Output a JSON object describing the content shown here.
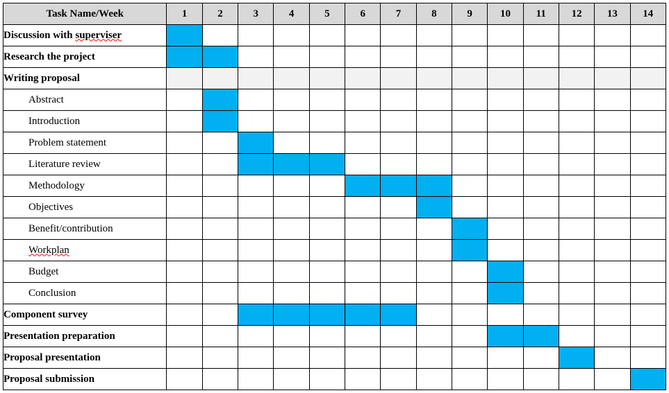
{
  "header": {
    "task_label": "Task Name/Week",
    "weeks": [
      "1",
      "2",
      "3",
      "4",
      "5",
      "6",
      "7",
      "8",
      "9",
      "10",
      "11",
      "12",
      "13",
      "14"
    ]
  },
  "rows": [
    {
      "label_html": "Discussion with <span class=\"squiggle\">superviser</span>",
      "bold": true,
      "indent": false,
      "fills": [
        1
      ],
      "shades": []
    },
    {
      "label_html": "Research the project",
      "bold": true,
      "indent": false,
      "fills": [
        1,
        2
      ],
      "shades": []
    },
    {
      "label_html": "Writing proposal",
      "bold": true,
      "indent": false,
      "fills": [],
      "shades": [
        1,
        2,
        3,
        4,
        5,
        6,
        7,
        8,
        9,
        10,
        11,
        12,
        13,
        14
      ]
    },
    {
      "label_html": "Abstract",
      "bold": false,
      "indent": true,
      "fills": [
        2
      ],
      "shades": []
    },
    {
      "label_html": "Introduction",
      "bold": false,
      "indent": true,
      "fills": [
        2
      ],
      "shades": []
    },
    {
      "label_html": "Problem statement",
      "bold": false,
      "indent": true,
      "fills": [
        3
      ],
      "shades": []
    },
    {
      "label_html": "Literature review",
      "bold": false,
      "indent": true,
      "fills": [
        3,
        4,
        5
      ],
      "shades": []
    },
    {
      "label_html": "Methodology",
      "bold": false,
      "indent": true,
      "fills": [
        6,
        7,
        8
      ],
      "shades": []
    },
    {
      "label_html": "Objectives",
      "bold": false,
      "indent": true,
      "fills": [
        8
      ],
      "shades": []
    },
    {
      "label_html": "Benefit/contribution",
      "bold": false,
      "indent": true,
      "fills": [
        9
      ],
      "shades": []
    },
    {
      "label_html": "<span class=\"squiggle\">Workplan</span>",
      "bold": false,
      "indent": true,
      "fills": [
        9
      ],
      "shades": []
    },
    {
      "label_html": "Budget",
      "bold": false,
      "indent": true,
      "fills": [
        10
      ],
      "shades": []
    },
    {
      "label_html": "Conclusion",
      "bold": false,
      "indent": true,
      "fills": [
        10
      ],
      "shades": []
    },
    {
      "label_html": "Component survey",
      "bold": true,
      "indent": false,
      "fills": [
        3,
        4,
        5,
        6,
        7
      ],
      "shades": []
    },
    {
      "label_html": "Presentation preparation",
      "bold": true,
      "indent": false,
      "fills": [
        10,
        11
      ],
      "shades": []
    },
    {
      "label_html": "Proposal presentation",
      "bold": true,
      "indent": false,
      "fills": [
        12
      ],
      "shades": []
    },
    {
      "label_html": "Proposal submission",
      "bold": true,
      "indent": false,
      "fills": [
        14
      ],
      "shades": []
    }
  ],
  "chart_data": {
    "type": "bar",
    "title": "",
    "xlabel": "Week",
    "ylabel": "Task",
    "xlim": [
      1,
      14
    ],
    "categories": [
      "Discussion with superviser",
      "Research the project",
      "Writing proposal",
      "Abstract",
      "Introduction",
      "Problem statement",
      "Literature review",
      "Methodology",
      "Objectives",
      "Benefit/contribution",
      "Workplan",
      "Budget",
      "Conclusion",
      "Component survey",
      "Presentation preparation",
      "Proposal presentation",
      "Proposal submission"
    ],
    "series": [
      {
        "name": "Discussion with superviser",
        "weeks": [
          1
        ]
      },
      {
        "name": "Research the project",
        "weeks": [
          1,
          2
        ]
      },
      {
        "name": "Writing proposal",
        "weeks": []
      },
      {
        "name": "Abstract",
        "weeks": [
          2
        ]
      },
      {
        "name": "Introduction",
        "weeks": [
          2
        ]
      },
      {
        "name": "Problem statement",
        "weeks": [
          3
        ]
      },
      {
        "name": "Literature review",
        "weeks": [
          3,
          4,
          5
        ]
      },
      {
        "name": "Methodology",
        "weeks": [
          6,
          7,
          8
        ]
      },
      {
        "name": "Objectives",
        "weeks": [
          8
        ]
      },
      {
        "name": "Benefit/contribution",
        "weeks": [
          9
        ]
      },
      {
        "name": "Workplan",
        "weeks": [
          9
        ]
      },
      {
        "name": "Budget",
        "weeks": [
          10
        ]
      },
      {
        "name": "Conclusion",
        "weeks": [
          10
        ]
      },
      {
        "name": "Component survey",
        "weeks": [
          3,
          4,
          5,
          6,
          7
        ]
      },
      {
        "name": "Presentation preparation",
        "weeks": [
          10,
          11
        ]
      },
      {
        "name": "Proposal presentation",
        "weeks": [
          12
        ]
      },
      {
        "name": "Proposal submission",
        "weeks": [
          14
        ]
      }
    ]
  }
}
